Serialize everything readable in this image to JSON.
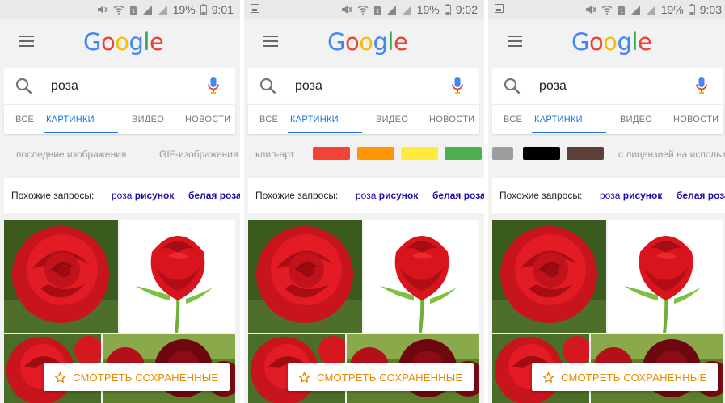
{
  "panels": [
    {
      "status": {
        "battery": "19%",
        "time": "9:01",
        "photo_icon": false
      },
      "chips_type": "text",
      "chips": [
        "последние изображения",
        "GIF-изображения"
      ]
    },
    {
      "status": {
        "battery": "19%",
        "time": "9:02",
        "photo_icon": true
      },
      "chips_type": "colors",
      "chips_label": "клип-арт",
      "colors": [
        "#f44336",
        "#ff9800",
        "#ffeb3b",
        "#4caf50"
      ]
    },
    {
      "status": {
        "battery": "19%",
        "time": "9:03",
        "photo_icon": true
      },
      "chips_type": "colors-then-text",
      "colors": [
        "#9e9e9e",
        "#000000",
        "#5d4037"
      ],
      "chips": [
        "с лицензией на использование"
      ]
    }
  ],
  "header": {
    "logo_letters": [
      "G",
      "o",
      "o",
      "g",
      "l",
      "e"
    ],
    "logo_colors": [
      "#4285f4",
      "#ea4335",
      "#fbbc05",
      "#4285f4",
      "#34a853",
      "#ea4335"
    ]
  },
  "search": {
    "query": "роза",
    "icons": [
      "search-icon",
      "mic-icon"
    ]
  },
  "tabs": [
    "ВСЕ",
    "КАРТИНКИ",
    "ВИДЕО",
    "НОВОСТИ"
  ],
  "active_tab": "КАРТИНКИ",
  "related": {
    "label": "Похожие запросы:",
    "links": [
      {
        "plain": "роза",
        "bold": "рисунок"
      },
      {
        "plain": "",
        "bold": "белая роза"
      }
    ]
  },
  "saved_button": {
    "label": "СМОТРЕТЬ СОХРАНЕННЫЕ",
    "icon": "star-icon"
  },
  "theme": {
    "accent": "#1a73e8",
    "link": "#1a0dab",
    "saved": "#e68a00"
  }
}
